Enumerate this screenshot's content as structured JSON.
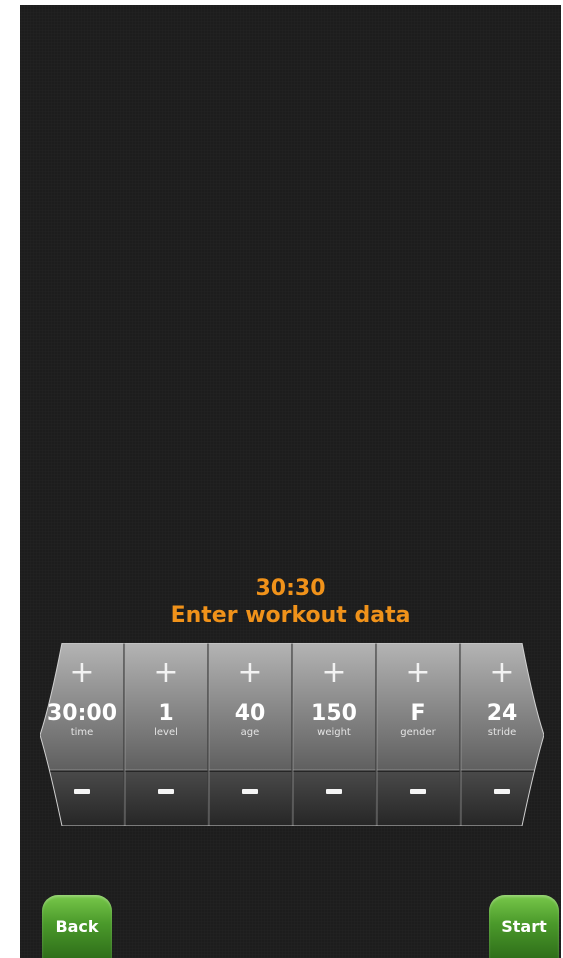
{
  "header": {
    "time": "30:30",
    "title": "Enter workout data"
  },
  "fields": [
    {
      "value": "30:00",
      "label": "time"
    },
    {
      "value": "1",
      "label": "level"
    },
    {
      "value": "40",
      "label": "age"
    },
    {
      "value": "150",
      "label": "weight"
    },
    {
      "value": "F",
      "label": "gender"
    },
    {
      "value": "24",
      "label": "stride"
    }
  ],
  "buttons": {
    "back": "Back",
    "start": "Start"
  },
  "colors": {
    "accent": "#f0921a",
    "button_green": "#4b9a2b",
    "background": "#1d1d1d"
  },
  "icons": {
    "increment": "plus-icon",
    "decrement": "minus-icon"
  }
}
